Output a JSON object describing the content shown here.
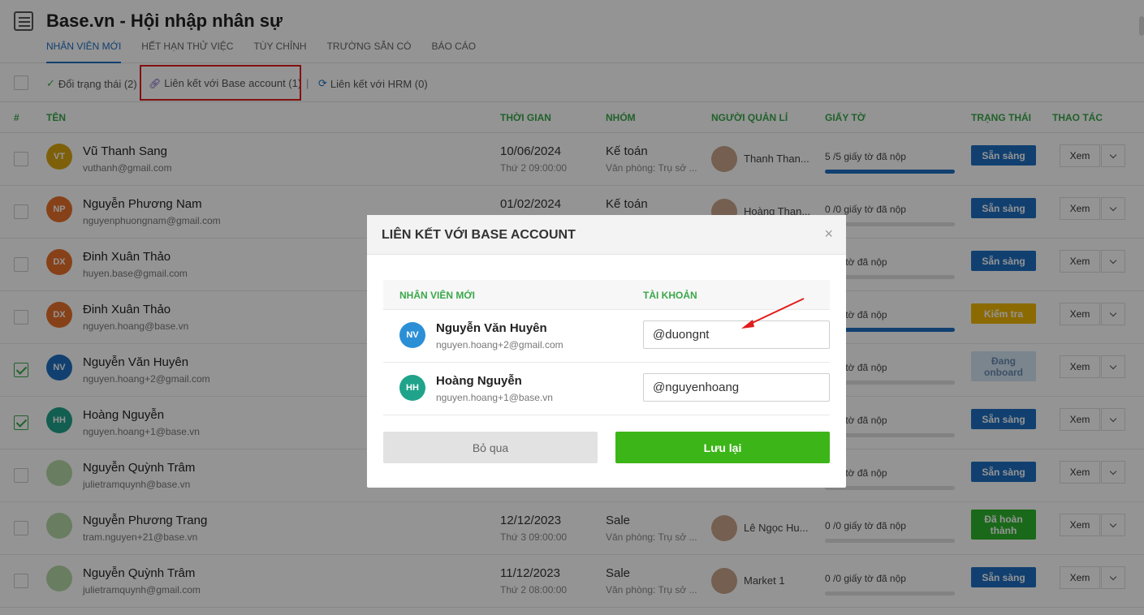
{
  "app": {
    "title": "Base.vn - Hội nhập nhân sự"
  },
  "tabs": [
    "NHÂN VIÊN MỚI",
    "HẾT HẠN THỬ VIỆC",
    "TÙY CHỈNH",
    "TRƯỜNG SẴN CÓ",
    "BÁO CÁO"
  ],
  "toolbar": {
    "change_status": "Đổi trạng thái (2)",
    "link_base": "Liên kết với Base account (1)",
    "separator": "|",
    "link_hrm": "Liên kết với HRM (0)"
  },
  "columns": [
    "#",
    "TÊN",
    "THỜI GIAN",
    "NHÓM",
    "NGƯỜI QUẢN LÍ",
    "GIẤY TỜ",
    "TRẠNG THÁI",
    "THAO TÁC"
  ],
  "rows": [
    {
      "initials": "VT",
      "avatar_color": "#d9a514",
      "name": "Vũ Thanh Sang",
      "email": "vuthanh@gmail.com",
      "date": "10/06/2024",
      "time": "Thứ 2 09:00:00",
      "group": "Kế toán",
      "office": "Văn phòng: Trụ sở ...",
      "manager": "Thanh Than...",
      "docs": "5 /5 giấy tờ đã nộp",
      "progress": 1.0,
      "status": "Sẵn sàng",
      "status_color": "#1e6fc2",
      "action": "Xem",
      "checked": false
    },
    {
      "initials": "NP",
      "avatar_color": "#e8702a",
      "name": "Nguyễn Phương Nam",
      "email": "nguyenphuongnam@gmail.com",
      "date": "01/02/2024",
      "time": "",
      "group": "Kế toán",
      "office": "",
      "manager": "Hoàng Than...",
      "docs": "0 /0 giấy tờ đã nộp",
      "progress": 0,
      "status": "Sẵn sàng",
      "status_color": "#1e6fc2",
      "action": "Xem",
      "checked": false
    },
    {
      "initials": "DX",
      "avatar_color": "#e8702a",
      "name": "Đinh Xuân Thảo",
      "email": "huyen.base@gmail.com",
      "date": "",
      "time": "",
      "group": "",
      "office": "",
      "manager": "",
      "docs": "giấy tờ đã nộp",
      "progress": 0,
      "status": "Sẵn sàng",
      "status_color": "#1e6fc2",
      "action": "Xem",
      "checked": false
    },
    {
      "initials": "DX",
      "avatar_color": "#e8702a",
      "name": "Đinh Xuân Thảo",
      "email": "nguyen.hoang@base.vn",
      "date": "",
      "time": "",
      "group": "",
      "office": "",
      "manager": "",
      "docs": "giấy tờ đã nộp",
      "progress": 1.0,
      "status": "Kiểm tra",
      "status_color": "#f2b705",
      "action": "Xem",
      "checked": false
    },
    {
      "initials": "NV",
      "avatar_color": "#1e6fc2",
      "name": "Nguyễn Văn Huyên",
      "email": "nguyen.hoang+2@gmail.com",
      "date": "",
      "time": "",
      "group": "",
      "office": "",
      "manager": "",
      "docs": "giấy tờ đã nộp",
      "progress": 0,
      "status": "Đang onboard",
      "status_color": "#d4e6f5",
      "action": "Xem",
      "checked": true
    },
    {
      "initials": "HH",
      "avatar_color": "#1fa38a",
      "name": "Hoàng Nguyễn",
      "email": "nguyen.hoang+1@base.vn",
      "date": "",
      "time": "",
      "group": "",
      "office": "",
      "manager": "",
      "docs": "giấy tờ đã nộp",
      "progress": 0,
      "status": "Sẵn sàng",
      "status_color": "#1e6fc2",
      "action": "Xem",
      "checked": true
    },
    {
      "initials": "",
      "avatar_color": "#b5d7a8",
      "name": "Nguyễn Quỳnh Trâm",
      "email": "julietramquynh@base.vn",
      "date": "",
      "time": "",
      "group": "",
      "office": "",
      "manager": "",
      "docs": "giấy tờ đã nộp",
      "progress": 0,
      "status": "Sẵn sàng",
      "status_color": "#1e6fc2",
      "action": "Xem",
      "checked": false
    },
    {
      "initials": "",
      "avatar_color": "#b5d7a8",
      "name": "Nguyễn Phương Trang",
      "email": "tram.nguyen+21@base.vn",
      "date": "12/12/2023",
      "time": "Thứ 3 09:00:00",
      "group": "Sale",
      "office": "Văn phòng: Trụ sở ...",
      "manager": "Lê Ngọc Hu...",
      "docs": "0 /0 giấy tờ đã nộp",
      "progress": 0,
      "status": "Đã hoàn thành",
      "status_color": "#2db52d",
      "action": "Xem",
      "checked": false
    },
    {
      "initials": "",
      "avatar_color": "#b5d7a8",
      "name": "Nguyễn Quỳnh Trâm",
      "email": "julietramquynh@gmail.com",
      "date": "11/12/2023",
      "time": "Thứ 2 08:00:00",
      "group": "Sale",
      "office": "Văn phòng: Trụ sở ...",
      "manager": "Market 1",
      "docs": "0 /0 giấy tờ đã nộp",
      "progress": 0,
      "status": "Sẵn sàng",
      "status_color": "#1e6fc2",
      "action": "Xem",
      "checked": false
    }
  ],
  "modal": {
    "title": "LIÊN KẾT VỚI BASE ACCOUNT",
    "close": "×",
    "col_employee": "NHÂN VIÊN MỚI",
    "col_account": "TÀI KHOẢN",
    "items": [
      {
        "initials": "NV",
        "avatar_color": "#2b8fd6",
        "name": "Nguyễn Văn Huyên",
        "email": "nguyen.hoang+2@gmail.com",
        "account": "@duongnt"
      },
      {
        "initials": "HH",
        "avatar_color": "#1fa38a",
        "name": "Hoàng Nguyễn",
        "email": "nguyen.hoang+1@base.vn",
        "account": "@nguyenhoang"
      }
    ],
    "skip_label": "Bỏ qua",
    "save_label": "Lưu lại"
  }
}
